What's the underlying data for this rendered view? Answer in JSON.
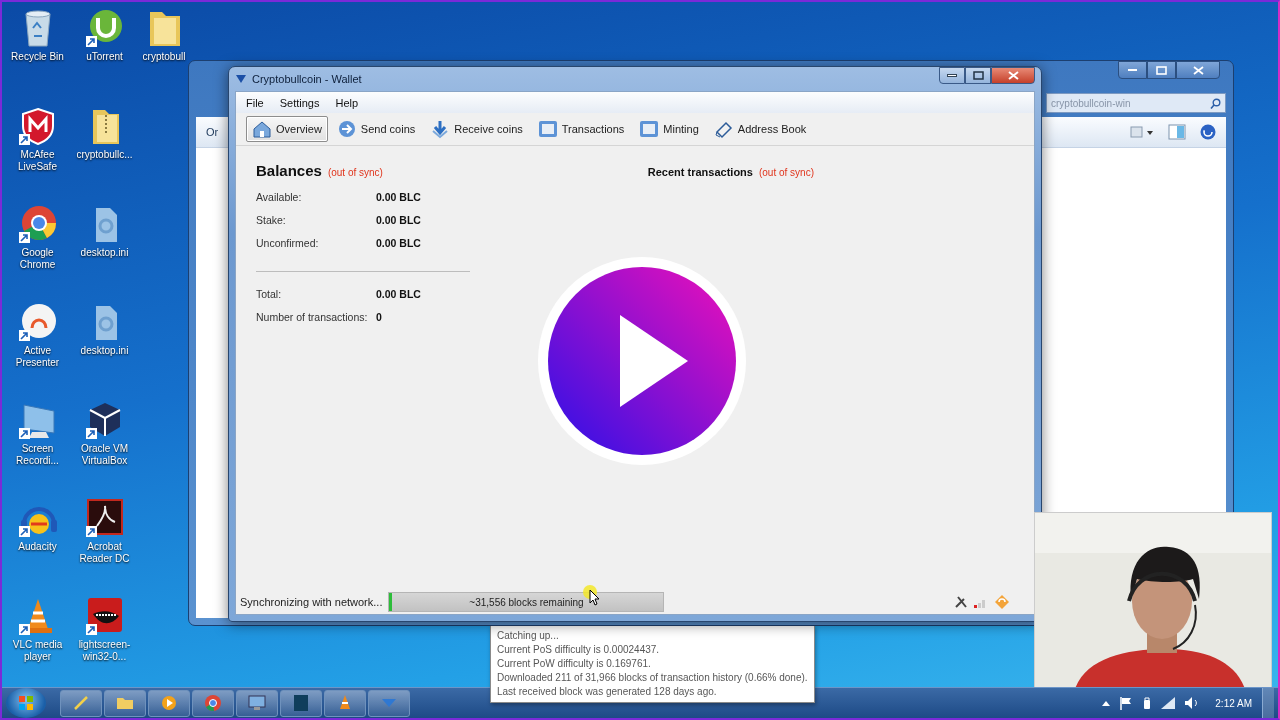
{
  "desktop_icons": [
    {
      "label": "Recycle Bin",
      "kind": "recycle"
    },
    {
      "label": "uTorrent",
      "kind": "torrent"
    },
    {
      "label": "cryptobull",
      "kind": "folder"
    },
    {
      "label": "McAfee LiveSafe",
      "kind": "shield"
    },
    {
      "label": "cryptobullc...",
      "kind": "zip"
    },
    {
      "label": "Google Chrome",
      "kind": "chrome"
    },
    {
      "label": "desktop.ini",
      "kind": "ini"
    },
    {
      "label": "Active Presenter",
      "kind": "presenter"
    },
    {
      "label": "desktop.ini",
      "kind": "ini"
    },
    {
      "label": "Screen Recordi...",
      "kind": "monitor"
    },
    {
      "label": "Oracle VM VirtualBox",
      "kind": "cube"
    },
    {
      "label": "Audacity",
      "kind": "headphones"
    },
    {
      "label": "Acrobat Reader DC",
      "kind": "acrobat"
    },
    {
      "label": "VLC media player",
      "kind": "cone"
    },
    {
      "label": "lightscreen-win32-0...",
      "kind": "mouth"
    }
  ],
  "explorer_window": {
    "organize": "Or",
    "search_placeholder": "cryptobullcoin-win"
  },
  "wallet": {
    "title": "Cryptobullcoin - Wallet",
    "menu": [
      "File",
      "Settings",
      "Help"
    ],
    "toolbar": [
      {
        "label": "Overview",
        "selected": true
      },
      {
        "label": "Send coins",
        "selected": false
      },
      {
        "label": "Receive coins",
        "selected": false
      },
      {
        "label": "Transactions",
        "selected": false
      },
      {
        "label": "Minting",
        "selected": false
      },
      {
        "label": "Address Book",
        "selected": false
      }
    ],
    "balances": {
      "heading": "Balances",
      "sync_note": "(out of sync)",
      "rows": [
        {
          "label": "Available:",
          "value": "0.00 BLC"
        },
        {
          "label": "Stake:",
          "value": "0.00 BLC"
        },
        {
          "label": "Unconfirmed:",
          "value": "0.00 BLC"
        }
      ],
      "totals": [
        {
          "label": "Total:",
          "value": "0.00 BLC"
        },
        {
          "label": "Number of transactions:",
          "value": "0"
        }
      ]
    },
    "recent": {
      "heading": "Recent transactions",
      "sync_note": "(out of sync)"
    },
    "status": {
      "text": "Synchronizing with network...",
      "progress": {
        "level": 0.01,
        "label": "~31,556 blocks remaining"
      }
    }
  },
  "tooltip": {
    "lines": [
      "Catching up...",
      "Current PoS difficulty is 0.00024437.",
      "Current PoW difficulty is 0.169761.",
      "Downloaded 211 of 31,966 blocks of transaction history (0.66% done).",
      "Last received block was generated 128 days ago."
    ]
  },
  "taskbar": {
    "clock": "2:12 AM"
  }
}
